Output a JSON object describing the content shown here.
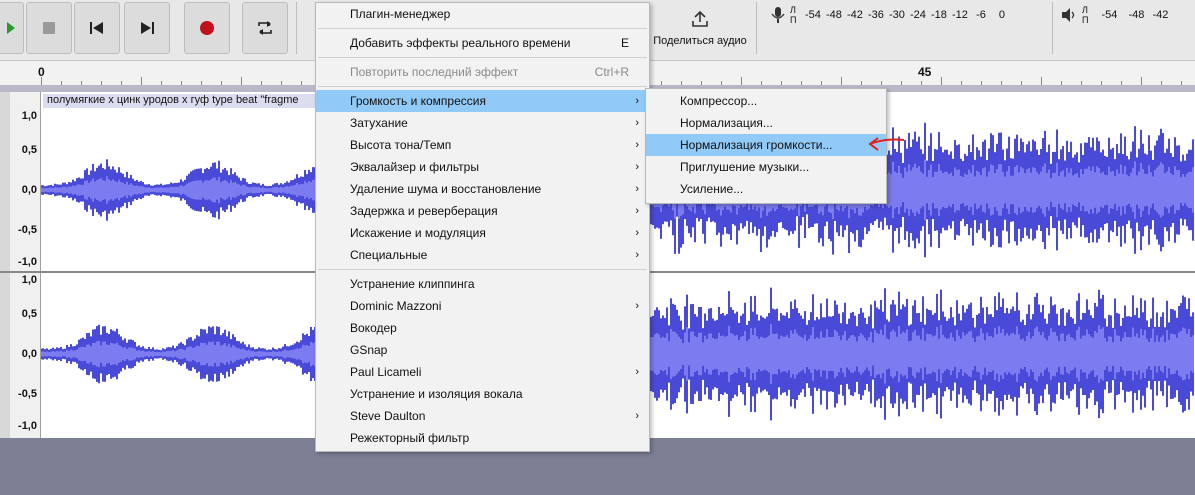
{
  "toolbar": {
    "share_label": "Поделиться аудио",
    "record_meter_letters": [
      "Л",
      "П"
    ],
    "record_meter_ticks": [
      "-54",
      "-48",
      "-42",
      "-36",
      "-30",
      "-24",
      "-18",
      "-12",
      "-6",
      "0"
    ],
    "playback_meter_letters": [
      "Л",
      "П"
    ],
    "playback_meter_ticks": [
      "-54",
      "-48",
      "-42"
    ]
  },
  "ruler": {
    "labels": [
      "0",
      "45"
    ]
  },
  "track": {
    "clip_name": "полумягкие х цинк уродов х гуф type beat \"fragme",
    "scale_labels": [
      "1,0",
      "0,5",
      "0,0",
      "-0,5",
      "-1,0"
    ]
  },
  "effects_menu": {
    "plugin_manager": "Плагин-менеджер",
    "add_realtime": "Добавить эффекты реального времени",
    "add_realtime_shortcut": "E",
    "repeat_last": "Повторить последний эффект",
    "repeat_last_shortcut": "Ctrl+R",
    "group1": [
      "Громкость и компрессия",
      "Затухание",
      "Высота тона/Темп",
      "Эквалайзер и фильтры",
      "Удаление шума и восстановление",
      "Задержка и реверберация",
      "Искажение и модуляция",
      "Специальные"
    ],
    "group2": [
      "Устранение клиппинга",
      "Dominic Mazzoni",
      "Вокодер",
      "GSnap",
      "Paul Licameli",
      "Устранение и изоляция вокала",
      "Steve Daulton",
      "Режекторный фильтр"
    ]
  },
  "submenu": {
    "items": [
      "Компрессор...",
      "Нормализация...",
      "Нормализация громкости...",
      "Приглушение музыки...",
      "Усиление..."
    ]
  },
  "colors": {
    "waveform": "#4a4ad8",
    "waveform_rms": "#7c7cf0",
    "highlight": "#91c9f7",
    "annotation_arrow": "#e02020"
  }
}
